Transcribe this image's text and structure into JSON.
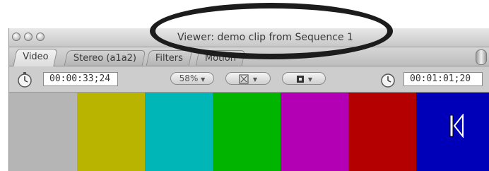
{
  "window": {
    "title": "Viewer: demo clip from Sequence 1"
  },
  "tabs": [
    {
      "label": "Video",
      "active": true
    },
    {
      "label": "Stereo (a1a2)",
      "active": false
    },
    {
      "label": "Filters",
      "active": false
    },
    {
      "label": "Motion",
      "active": false
    }
  ],
  "toolbar": {
    "current_timecode": "00:00:33;24",
    "zoom_label": "58%",
    "view_menu_icon": "view-mode-icon",
    "overlay_menu_icon": "overlay-icon",
    "duration_timecode": "00:01:01;20"
  },
  "colors": {
    "bars": [
      "#b5b5b5",
      "#b9b400",
      "#00b6b6",
      "#00b400",
      "#b400b4",
      "#b40000",
      "#0000b8"
    ]
  },
  "icons": {
    "end_marker": "out-point-icon"
  }
}
